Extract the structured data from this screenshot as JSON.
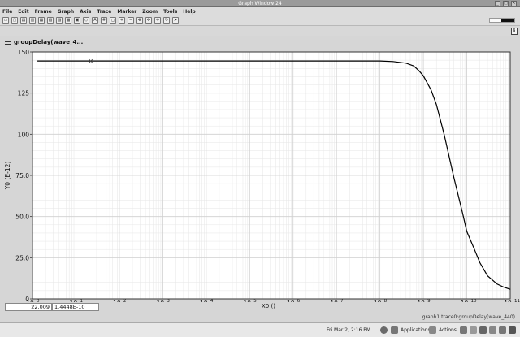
{
  "window": {
    "title": "Graph Window 24"
  },
  "menu": [
    "File",
    "Edit",
    "Frame",
    "Graph",
    "Axis",
    "Trace",
    "Marker",
    "Zoom",
    "Tools",
    "Help"
  ],
  "trace_label": "groupDelay(wave_4...",
  "readout": {
    "x": "22.009",
    "y": "1.4448E-10"
  },
  "status_text": "graph1.trace0:groupDelay(wave_440)",
  "taskbar": {
    "clock": "Fri Mar  2,  2:16 PM",
    "applications": "Applications",
    "actions": "Actions"
  },
  "colors": {
    "background": "#d6d6d6",
    "plot_bg": "#ffffff",
    "trace": "#000000",
    "grid": "#cfcfcf"
  },
  "chart_data": {
    "type": "line",
    "x_scale": "log",
    "xlim": [
      1,
      100000000000
    ],
    "ylim": [
      0,
      150
    ],
    "xlabel": "X0 ()",
    "ylabel": "Y0 (E-12)",
    "y_ticks": [
      "0",
      "25.0",
      "50.0",
      "75.0",
      "100",
      "125",
      "150"
    ],
    "x_ticks": [
      {
        "base": "10",
        "exp": "0"
      },
      {
        "base": "10",
        "exp": "1"
      },
      {
        "base": "10",
        "exp": "2"
      },
      {
        "base": "10",
        "exp": "3"
      },
      {
        "base": "10",
        "exp": "4"
      },
      {
        "base": "10",
        "exp": "5"
      },
      {
        "base": "10",
        "exp": "6"
      },
      {
        "base": "10",
        "exp": "7"
      },
      {
        "base": "10",
        "exp": "8"
      },
      {
        "base": "10",
        "exp": "9"
      },
      {
        "base": "10",
        "exp": "10"
      },
      {
        "base": "10",
        "exp": "11"
      }
    ],
    "grid": true,
    "series": [
      {
        "x": [
          1.3,
          10,
          100,
          1000,
          10000,
          100000,
          1000000,
          10000000,
          100000000,
          200000000,
          400000000,
          600000000,
          800000000,
          1000000000,
          1500000000,
          2000000000,
          3000000000,
          5000000000,
          8000000000,
          10000000000,
          15000000000,
          20000000000,
          30000000000,
          50000000000,
          70000000000,
          100000000000
        ],
        "y": [
          144.5,
          144.5,
          144.5,
          144.5,
          144.5,
          144.5,
          144.5,
          144.5,
          144.5,
          144.2,
          143.2,
          141.5,
          138.5,
          135.5,
          127,
          118,
          100,
          74,
          52,
          41,
          30,
          22,
          14,
          9,
          7.2,
          5.8
        ]
      }
    ],
    "cursor": {
      "x": 22.009,
      "y": 144.48
    }
  }
}
